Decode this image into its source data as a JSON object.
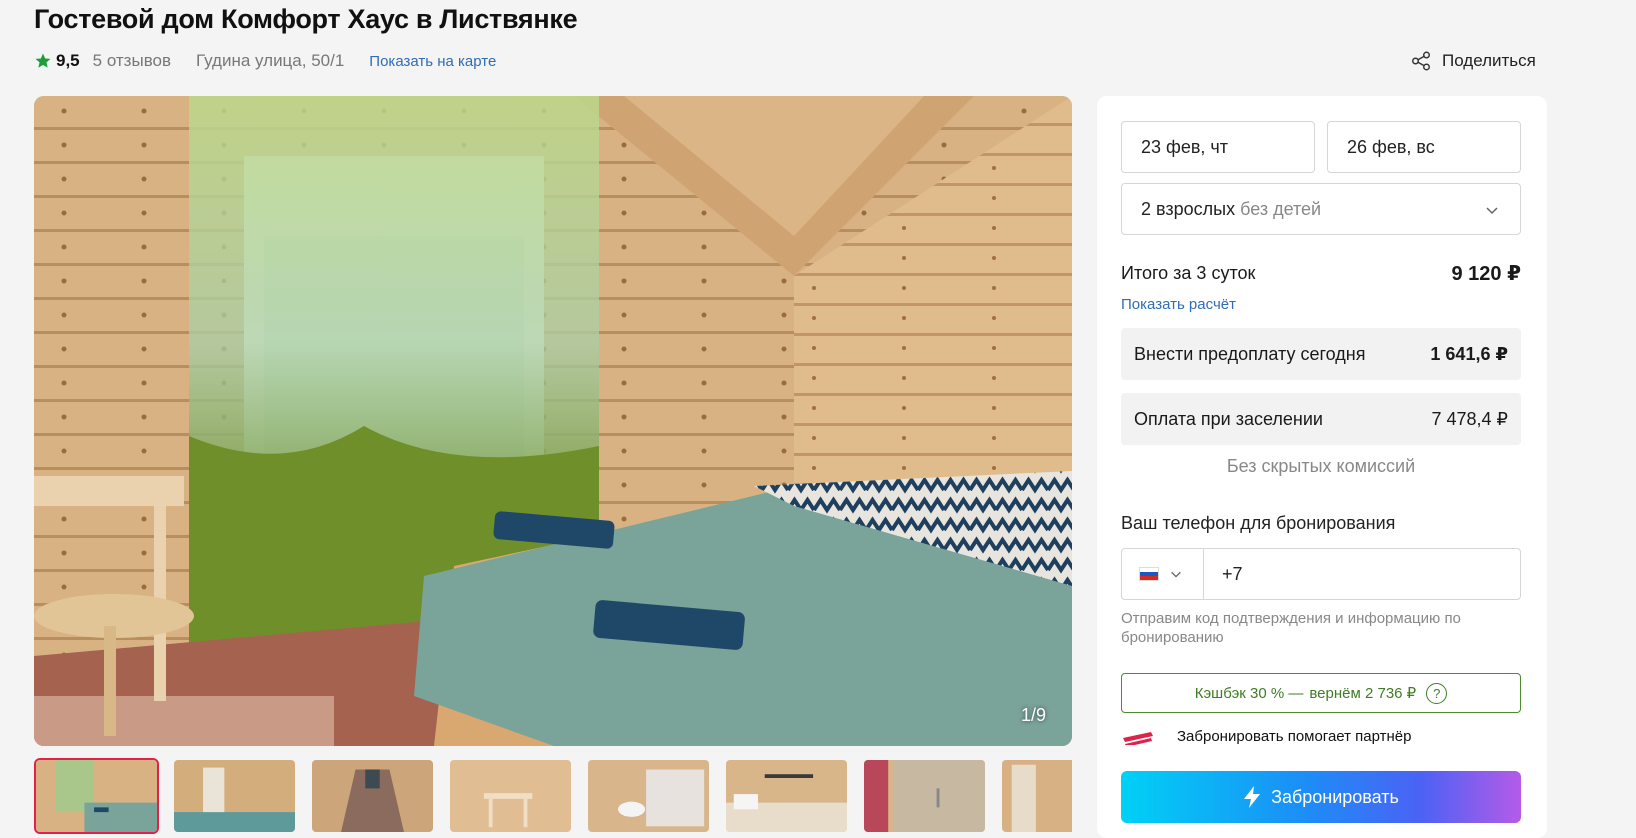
{
  "listing": {
    "title": "Гостевой дом Комфорт Хаус в Листвянке",
    "rating": "9,5",
    "reviews": "5 отзывов",
    "address": "Гудина улица, 50/1",
    "map_link": "Показать на карте",
    "share_label": "Поделиться"
  },
  "gallery": {
    "counter": "1/9",
    "thumbnails": [
      "bedroom",
      "room-with-door",
      "corridor",
      "table-corner",
      "bathroom",
      "kitchenette",
      "shower",
      "door"
    ]
  },
  "booking": {
    "checkin": "23 фев, чт",
    "checkout": "26 фев, вс",
    "guests_main": "2 взрослых",
    "guests_sub": "без детей",
    "total_label": "Итого за 3 суток",
    "total_value": "9 120 ₽",
    "calc_link": "Показать расчёт",
    "prepay_label": "Внести предоплату сегодня",
    "prepay_value": "1 641,6 ₽",
    "onsite_label": "Оплата при заселении",
    "onsite_value": "7 478,4 ₽",
    "no_fees": "Без скрытых комиссий",
    "phone_label": "Ваш телефон для бронирования",
    "phone_value": "+7",
    "phone_note": "Отправим код подтверждения и информацию по бронированию",
    "cashback_text": "Кэшбэк 30 % —",
    "cashback_return": "вернём 2 736 ₽",
    "cashback_help": "?",
    "partner_text": "Забронировать помогает партнёр",
    "book_button": "Забронировать"
  },
  "colors": {
    "accent_link": "#2f6db5",
    "star": "#1f9d3c",
    "cashback": "#3f7d22",
    "active_thumb": "#e0224a"
  },
  "icons": [
    "star-icon",
    "share-icon",
    "chevron-down-icon",
    "russia-flag-icon",
    "partner-logo-icon",
    "lightning-icon"
  ]
}
